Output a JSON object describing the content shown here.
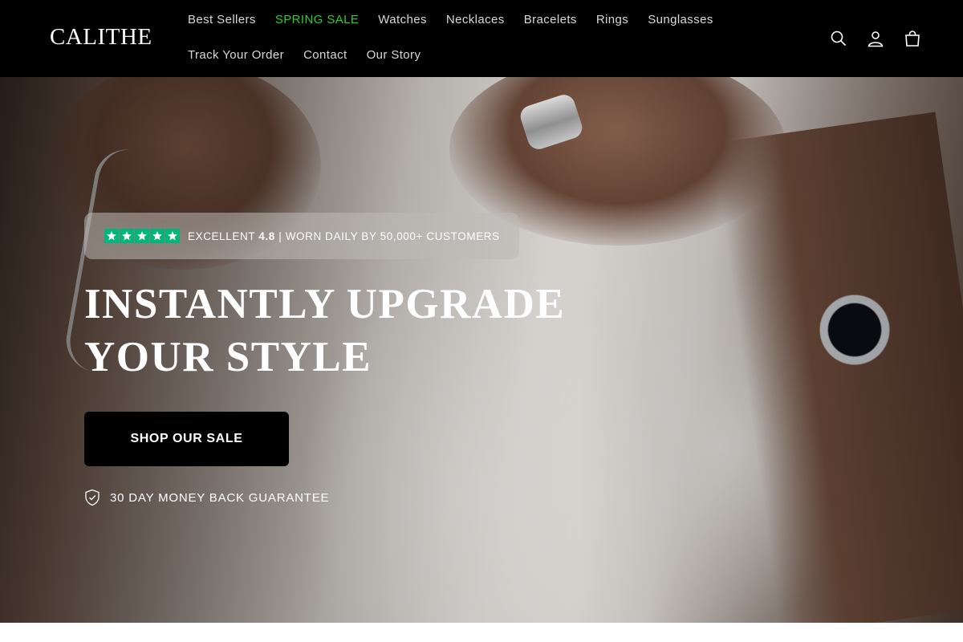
{
  "brand": {
    "logo_text": "CALITHE"
  },
  "nav": {
    "row1": [
      {
        "label": "Best Sellers"
      },
      {
        "label": "SPRING SALE"
      },
      {
        "label": "Watches"
      },
      {
        "label": "Necklaces"
      },
      {
        "label": "Bracelets"
      },
      {
        "label": "Rings"
      },
      {
        "label": "Sunglasses"
      }
    ],
    "row2": [
      {
        "label": "Track Your Order"
      },
      {
        "label": "Contact"
      },
      {
        "label": "Our Story"
      }
    ]
  },
  "header_icons": [
    "search-icon",
    "account-icon",
    "cart-icon"
  ],
  "hero": {
    "review": {
      "rating_word": "EXCELLENT",
      "rating_value": "4.8",
      "tagline": "| WORN DAILY BY 50,000+ CUSTOMERS",
      "stars": 5
    },
    "headline_line1": "INSTANTLY UPGRADE",
    "headline_line2": "YOUR STYLE",
    "cta_label": "SHOP OUR SALE",
    "guarantee_text": "30 DAY MONEY BACK GUARANTEE"
  },
  "colors": {
    "header_bg": "#000000",
    "sale_link": "#2ecc2e",
    "star_green": "#00b67a",
    "cta_bg": "#000000"
  }
}
